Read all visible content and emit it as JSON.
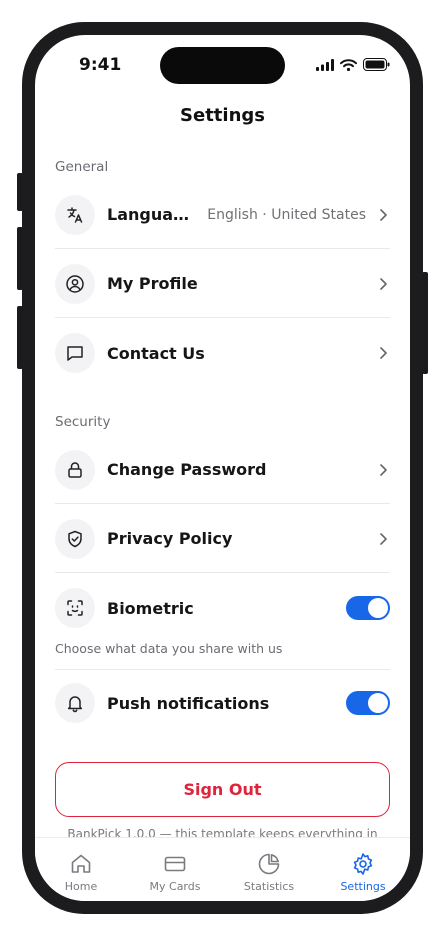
{
  "status_bar": {
    "time": "9:41"
  },
  "header": {
    "title": "Settings"
  },
  "sections": {
    "general": {
      "label": "General",
      "language": {
        "label": "Langua…",
        "value": "English · United States",
        "icon": "translate-icon"
      },
      "profile": {
        "label": "My Profile",
        "icon": "user-circle-icon"
      },
      "contact": {
        "label": "Contact Us",
        "icon": "message-square-icon"
      }
    },
    "security": {
      "label": "Security",
      "password": {
        "label": "Change Password",
        "icon": "lock-icon"
      },
      "privacy": {
        "label": "Privacy Policy",
        "icon": "shield-check-icon"
      },
      "biometric": {
        "label": "Biometric",
        "icon": "face-scan-icon",
        "enabled": true
      },
      "biometric_helper": "Choose what data you share with us",
      "push": {
        "label": "Push notifications",
        "icon": "bell-icon",
        "enabled": true
      }
    }
  },
  "sign_out": {
    "label": "Sign Out"
  },
  "footer": {
    "text": "BankPick 1.0.0 — this template keeps everything in"
  },
  "tabbar": {
    "tabs": [
      {
        "label": "Home",
        "icon": "home-icon",
        "active": false
      },
      {
        "label": "My Cards",
        "icon": "card-icon",
        "active": false
      },
      {
        "label": "Statistics",
        "icon": "pie-chart-icon",
        "active": false
      },
      {
        "label": "Settings",
        "icon": "gear-icon",
        "active": true
      }
    ]
  },
  "colors": {
    "accent": "#1767e8",
    "danger": "#e0223a",
    "text": "#161616",
    "muted": "#6b6b73"
  }
}
